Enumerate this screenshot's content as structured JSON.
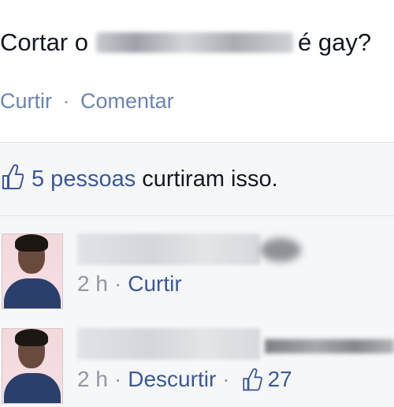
{
  "post": {
    "text_before": "Cortar o",
    "text_after": "é gay?",
    "actions": {
      "like": "Curtir",
      "separator": "·",
      "comment": "Comentar"
    }
  },
  "likes": {
    "count_text": "5 pessoas",
    "rest_text": "curtiram isso."
  },
  "comments": [
    {
      "time": "2 h",
      "separator": "·",
      "action": "Curtir"
    },
    {
      "time": "2 h",
      "separator": "·",
      "action": "Descurtir",
      "likes": "27"
    }
  ],
  "colors": {
    "link": "#3b5998",
    "muted": "#9197a3",
    "text": "#141823"
  }
}
